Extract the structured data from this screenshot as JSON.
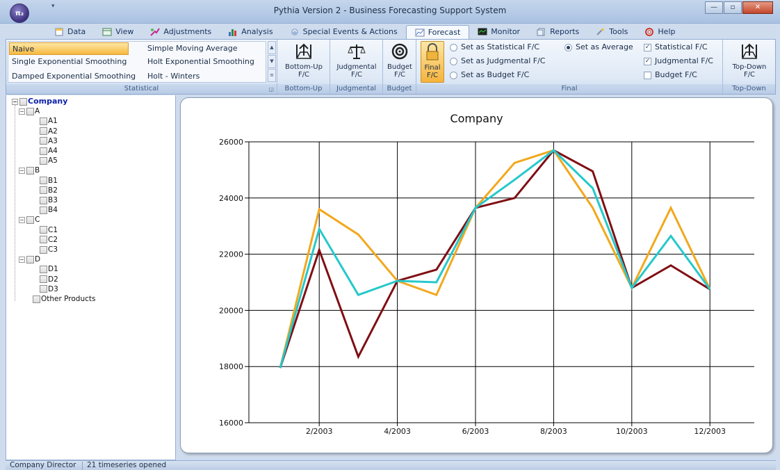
{
  "window": {
    "title": "Pythia Version 2 - Business Forecasting Support System",
    "orb_label": "π₂"
  },
  "tabs": [
    {
      "label": "Data",
      "icon": "data-icon"
    },
    {
      "label": "View",
      "icon": "view-icon"
    },
    {
      "label": "Adjustments",
      "icon": "adjustments-icon"
    },
    {
      "label": "Analysis",
      "icon": "analysis-icon"
    },
    {
      "label": "Special Events & Actions",
      "icon": "special-events-icon"
    },
    {
      "label": "Forecast",
      "icon": "forecast-icon",
      "active": true
    },
    {
      "label": "Monitor",
      "icon": "monitor-icon"
    },
    {
      "label": "Reports",
      "icon": "reports-icon"
    },
    {
      "label": "Tools",
      "icon": "tools-icon"
    },
    {
      "label": "Help",
      "icon": "help-icon"
    }
  ],
  "ribbon": {
    "statistical": {
      "label": "Statistical",
      "methods": [
        "Naive",
        "Simple Moving Average",
        "Single Exponential Smoothing",
        "Holt Exponential Smoothing",
        "Damped Exponential Smoothing",
        "Holt - Winters"
      ],
      "selected": "Naive"
    },
    "bottom_up": {
      "button": "Bottom-Up F/C",
      "label": "Bottom-Up"
    },
    "judgmental": {
      "button": "Judgmental F/C",
      "label": "Judgmental"
    },
    "budget": {
      "button": "Budget F/C",
      "label": "Budget"
    },
    "final": {
      "button": "Final F/C",
      "label": "Final",
      "radios": [
        {
          "label": "Set as Statistical F/C",
          "checked": false
        },
        {
          "label": "Set as Judgmental F/C",
          "checked": false
        },
        {
          "label": "Set as Budget F/C",
          "checked": false
        },
        {
          "label": "Set as Average",
          "checked": true
        }
      ],
      "checks": [
        {
          "label": "Statistical F/C",
          "checked": true
        },
        {
          "label": "Judgmental F/C",
          "checked": true
        },
        {
          "label": "Budget F/C",
          "checked": false
        }
      ]
    },
    "top_down": {
      "button": "Top-Down F/C",
      "label": "Top-Down"
    }
  },
  "tree": {
    "root": "Company",
    "groups": [
      {
        "name": "A",
        "children": [
          "A1",
          "A2",
          "A3",
          "A4",
          "A5"
        ]
      },
      {
        "name": "B",
        "children": [
          "B1",
          "B2",
          "B3",
          "B4"
        ]
      },
      {
        "name": "C",
        "children": [
          "C1",
          "C2",
          "C3"
        ]
      },
      {
        "name": "D",
        "children": [
          "D1",
          "D2",
          "D3"
        ]
      }
    ],
    "other": "Other Products"
  },
  "chart_data": {
    "type": "line",
    "title": "Company",
    "x": [
      "1/2003",
      "2/2003",
      "3/2003",
      "4/2003",
      "5/2003",
      "6/2003",
      "7/2003",
      "8/2003",
      "9/2003",
      "10/2003",
      "11/2003",
      "12/2003"
    ],
    "x_tick_labels": [
      "2/2003",
      "4/2003",
      "6/2003",
      "8/2003",
      "10/2003",
      "12/2003"
    ],
    "ylim": [
      16000,
      26000
    ],
    "y_ticks": [
      16000,
      18000,
      20000,
      22000,
      24000,
      26000
    ],
    "grid": true,
    "series": [
      {
        "color": "#f2a81d",
        "values": [
          17950,
          23600,
          22700,
          21050,
          20550,
          23650,
          25250,
          25700,
          23650,
          20800,
          23650,
          20750
        ]
      },
      {
        "color": "#7f0f14",
        "values": [
          17950,
          22150,
          18350,
          21050,
          21450,
          23650,
          24000,
          25700,
          24950,
          20800,
          21600,
          20750
        ]
      },
      {
        "color": "#25c8cc",
        "values": [
          17950,
          22900,
          20550,
          21050,
          21000,
          23650,
          24650,
          25700,
          24350,
          20800,
          22650,
          20750
        ]
      }
    ]
  },
  "statusbar": {
    "user": "Company Director",
    "info": "21 timeseries opened"
  }
}
